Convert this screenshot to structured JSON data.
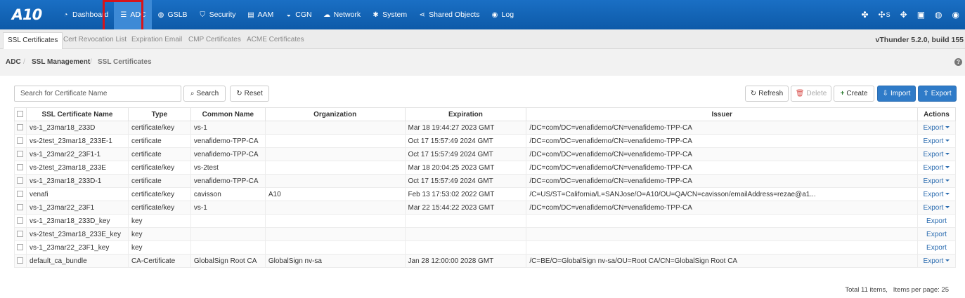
{
  "nav": {
    "logo": "A10",
    "items": [
      {
        "label": "Dashboard",
        "icon": "dashboard-icon",
        "glyph": "◔"
      },
      {
        "label": "ADC",
        "icon": "list-icon",
        "glyph": "☰"
      },
      {
        "label": "GSLB",
        "icon": "globe-icon",
        "glyph": "◍"
      },
      {
        "label": "Security",
        "icon": "shield-icon",
        "glyph": "⛉"
      },
      {
        "label": "AAM",
        "icon": "id-card-icon",
        "glyph": "▤"
      },
      {
        "label": "CGN",
        "icon": "car-icon",
        "glyph": "◒"
      },
      {
        "label": "Network",
        "icon": "cloud-icon",
        "glyph": "☁"
      },
      {
        "label": "System",
        "icon": "gear-icon",
        "glyph": "✱"
      },
      {
        "label": "Shared Objects",
        "icon": "share-icon",
        "glyph": "⋖"
      },
      {
        "label": "Log",
        "icon": "eye-icon",
        "glyph": "◉"
      }
    ],
    "right_icons": [
      {
        "icon": "cubes-icon",
        "glyph": "✤"
      },
      {
        "icon": "servers-icon",
        "glyph": "✣"
      },
      {
        "icon": "crosshair-icon",
        "glyph": "✥"
      },
      {
        "icon": "save-icon",
        "glyph": "▣"
      },
      {
        "icon": "globe-icon",
        "glyph": "◍"
      },
      {
        "icon": "user-icon",
        "glyph": "◉"
      }
    ],
    "right_badge": "S"
  },
  "subtabs": [
    "SSL Certificates",
    "Cert Revocation List",
    "Expiration Email",
    "CMP Certificates",
    "ACME Certificates"
  ],
  "version": "vThunder 5.2.0, build 155",
  "breadcrumb": {
    "root": "ADC",
    "section": "SSL Management",
    "page": "SSL Certificates"
  },
  "search": {
    "placeholder": "Search for Certificate Name",
    "value": ""
  },
  "buttons": {
    "search": "Search",
    "reset": "Reset",
    "refresh": "Refresh",
    "delete": "Delete",
    "create": "Create",
    "import": "Import",
    "export": "Export"
  },
  "table": {
    "headers": [
      "SSL Certificate Name",
      "Type",
      "Common Name",
      "Organization",
      "Expiration",
      "Issuer",
      "Actions"
    ],
    "rows": [
      {
        "name": "vs-1_23mar18_233D",
        "type": "certificate/key",
        "common": "vs-1",
        "org": "",
        "exp": "Mar 18 19:44:27 2023 GMT",
        "issuer": "/DC=com/DC=venafidemo/CN=venafidemo-TPP-CA",
        "action": "Export",
        "dropdown": true
      },
      {
        "name": "vs-2test_23mar18_233E-1",
        "type": "certificate",
        "common": "venafidemo-TPP-CA",
        "org": "",
        "exp": "Oct 17 15:57:49 2024 GMT",
        "issuer": "/DC=com/DC=venafidemo/CN=venafidemo-TPP-CA",
        "action": "Export",
        "dropdown": true
      },
      {
        "name": "vs-1_23mar22_23F1-1",
        "type": "certificate",
        "common": "venafidemo-TPP-CA",
        "org": "",
        "exp": "Oct 17 15:57:49 2024 GMT",
        "issuer": "/DC=com/DC=venafidemo/CN=venafidemo-TPP-CA",
        "action": "Export",
        "dropdown": true
      },
      {
        "name": "vs-2test_23mar18_233E",
        "type": "certificate/key",
        "common": "vs-2test",
        "org": "",
        "exp": "Mar 18 20:04:25 2023 GMT",
        "issuer": "/DC=com/DC=venafidemo/CN=venafidemo-TPP-CA",
        "action": "Export",
        "dropdown": true
      },
      {
        "name": "vs-1_23mar18_233D-1",
        "type": "certificate",
        "common": "venafidemo-TPP-CA",
        "org": "",
        "exp": "Oct 17 15:57:49 2024 GMT",
        "issuer": "/DC=com/DC=venafidemo/CN=venafidemo-TPP-CA",
        "action": "Export",
        "dropdown": true
      },
      {
        "name": "venafi",
        "type": "certificate/key",
        "common": "cavisson",
        "org": "A10",
        "exp": "Feb 13 17:53:02 2022 GMT",
        "issuer": "/C=US/ST=California/L=SANJose/O=A10/OU=QA/CN=cavisson/emailAddress=rezae@a1...",
        "action": "Export",
        "dropdown": true
      },
      {
        "name": "vs-1_23mar22_23F1",
        "type": "certificate/key",
        "common": "vs-1",
        "org": "",
        "exp": "Mar 22 15:44:22 2023 GMT",
        "issuer": "/DC=com/DC=venafidemo/CN=venafidemo-TPP-CA",
        "action": "Export",
        "dropdown": true
      },
      {
        "name": "vs-1_23mar18_233D_key",
        "type": "key",
        "common": "",
        "org": "",
        "exp": "",
        "issuer": "",
        "action": "Export",
        "dropdown": false
      },
      {
        "name": "vs-2test_23mar18_233E_key",
        "type": "key",
        "common": "",
        "org": "",
        "exp": "",
        "issuer": "",
        "action": "Export",
        "dropdown": false
      },
      {
        "name": "vs-1_23mar22_23F1_key",
        "type": "key",
        "common": "",
        "org": "",
        "exp": "",
        "issuer": "",
        "action": "Export",
        "dropdown": false
      },
      {
        "name": "default_ca_bundle",
        "type": "CA-Certificate",
        "common": "GlobalSign Root CA",
        "org": "GlobalSign nv-sa",
        "exp": "Jan 28 12:00:00 2028 GMT",
        "issuer": "/C=BE/O=GlobalSign nv-sa/OU=Root CA/CN=GlobalSign Root CA",
        "action": "Export",
        "dropdown": true
      }
    ]
  },
  "footer": {
    "total": "Total 11 items,",
    "per_page": "Items per page: 25"
  },
  "colors": {
    "nav_bg": "#0f62b8",
    "nav_active": "#3d8ad6",
    "highlight": "#d7141a",
    "primary_btn": "#2f7bc8",
    "link": "#2b6cb0"
  }
}
